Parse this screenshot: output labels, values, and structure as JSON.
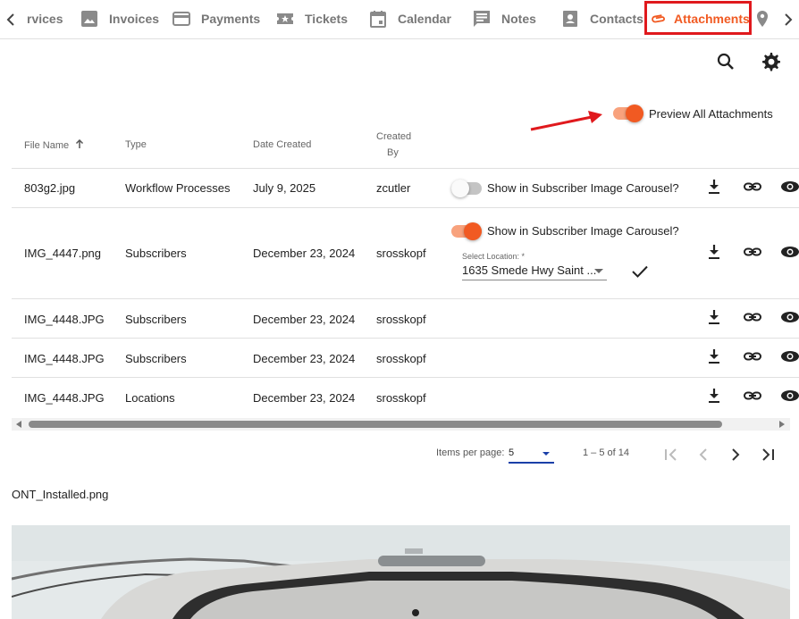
{
  "tabs": [
    {
      "label": "rvices",
      "icon": "services-icon",
      "active": false
    },
    {
      "label": "Invoices",
      "icon": "photo-icon",
      "active": false
    },
    {
      "label": "Payments",
      "icon": "credit-card-icon",
      "active": false
    },
    {
      "label": "Tickets",
      "icon": "ticket-icon",
      "active": false
    },
    {
      "label": "Calendar",
      "icon": "calendar-icon",
      "active": false
    },
    {
      "label": "Notes",
      "icon": "comment-icon",
      "active": false
    },
    {
      "label": "Contacts",
      "icon": "contact-icon",
      "active": false
    },
    {
      "label": "Attachments",
      "icon": "paperclip-icon",
      "active": true
    },
    {
      "label": "",
      "icon": "location-pin-icon",
      "active": false
    }
  ],
  "colors": {
    "accent": "#f15a22",
    "highlight_box": "#e0191d",
    "paginator": "#1a3fa8"
  },
  "toolbar": {
    "search_icon": "search-icon",
    "settings_icon": "gear-icon"
  },
  "preview_all": {
    "label": "Preview All Attachments",
    "enabled": true
  },
  "table": {
    "headers": {
      "file_name": "File Name",
      "type": "Type",
      "date_created": "Date Created",
      "created_by_1": "Created",
      "created_by_2": "By"
    },
    "sort_icon": "arrow-up-icon",
    "rows": [
      {
        "file_name": "803g2.jpg",
        "type": "Workflow Processes",
        "date": "July 9, 2025",
        "created_by": "zcutler",
        "carousel": {
          "shown": true,
          "on": false,
          "label": "Show in Subscriber Image Carousel?"
        }
      },
      {
        "file_name": "IMG_4447.png",
        "type": "Subscribers",
        "date": "December 23, 2024",
        "created_by": "srosskopf",
        "carousel": {
          "shown": true,
          "on": true,
          "label": "Show in Subscriber Image Carousel?"
        },
        "location": {
          "label": "Select Location: *",
          "value": "1635 Smede Hwy Saint ..."
        }
      },
      {
        "file_name": "IMG_4448.JPG",
        "type": "Subscribers",
        "date": "December 23, 2024",
        "created_by": "srosskopf"
      },
      {
        "file_name": "IMG_4448.JPG",
        "type": "Subscribers",
        "date": "December 23, 2024",
        "created_by": "srosskopf"
      },
      {
        "file_name": "IMG_4448.JPG",
        "type": "Locations",
        "date": "December 23, 2024",
        "created_by": "srosskopf"
      }
    ],
    "row_actions": [
      "download-icon",
      "link-icon",
      "visibility-icon"
    ]
  },
  "paginator": {
    "items_label": "Items per page:",
    "page_size": "5",
    "range": "1 – 5 of 14"
  },
  "preview": {
    "filename": "ONT_Installed.png"
  }
}
